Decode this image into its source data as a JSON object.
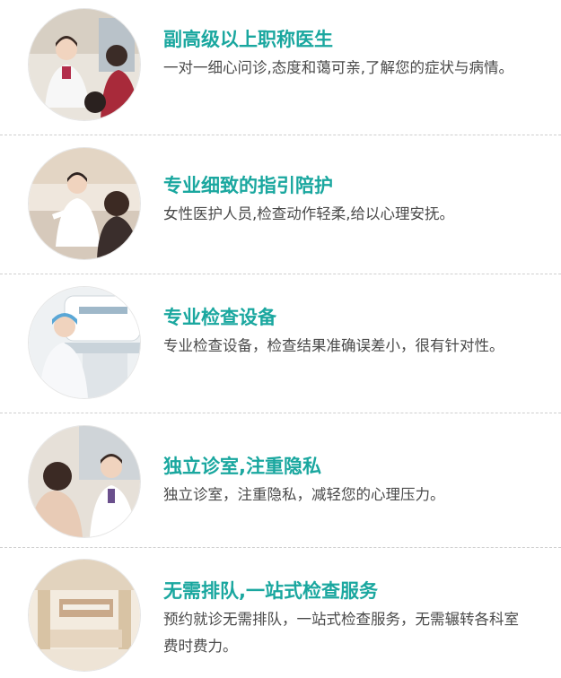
{
  "features": [
    {
      "title": "副高级以上职称医生",
      "description": "一对一细心问诊,态度和蔼可亲,了解您的症状与病情。",
      "photo_icon": "doctor-consultation-photo"
    },
    {
      "title": "专业细致的指引陪护",
      "description": "女性医护人员,检查动作轻柔,给以心理安抚。",
      "photo_icon": "nurse-guidance-photo"
    },
    {
      "title": "专业检查设备",
      "description": "专业检查设备，检查结果准确误差小，很有针对性。",
      "photo_icon": "examination-equipment-photo"
    },
    {
      "title": "独立诊室,注重隐私",
      "description": "独立诊室，注重隐私，减轻您的心理压力。",
      "photo_icon": "private-room-photo"
    },
    {
      "title": "无需排队,一站式检查服务",
      "description": "预约就诊无需排队，一站式检查服务，无需辗转各科室费时费力。",
      "photo_icon": "hospital-lobby-photo"
    }
  ]
}
